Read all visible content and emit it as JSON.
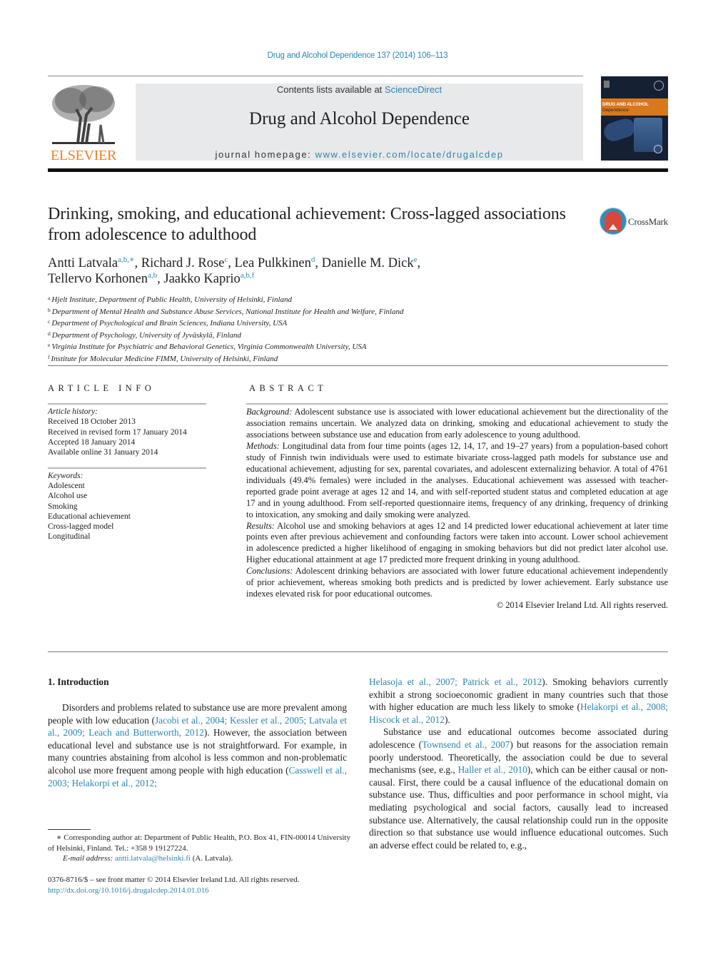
{
  "header": {
    "citation": "Drug and Alcohol Dependence 137 (2014) 106–113",
    "contents_prefix": "Contents lists available at ",
    "contents_link": "ScienceDirect",
    "journal_title": "Drug and Alcohol Dependence",
    "homepage_prefix": "journal homepage: ",
    "homepage_link": "www.elsevier.com/locate/drugalcdep",
    "publisher_logo_text": "ELSEVIER",
    "cover_title": "DRUG AND ALCOHOL",
    "cover_subtitle": "Dependence",
    "colors": {
      "link": "#2a86b0",
      "elsevier_orange": "#f07f2a",
      "cover_orange": "#d7781d"
    }
  },
  "article": {
    "title": "Drinking, smoking, and educational achievement: Cross-lagged associations from adolescence to adulthood",
    "crossmark_label": "CrossMark",
    "authors": [
      {
        "name": "Antti Latvala",
        "sup": "a,b,∗",
        "sep": ", "
      },
      {
        "name": "Richard J. Rose",
        "sup": "c",
        "sep": ", "
      },
      {
        "name": "Lea Pulkkinen",
        "sup": "d",
        "sep": ", "
      },
      {
        "name": "Danielle M. Dick",
        "sup": "e",
        "sep": ","
      },
      {
        "name": "Tellervo Korhonen",
        "sup": "a,b",
        "sep": ", "
      },
      {
        "name": "Jaakko Kaprio",
        "sup": "a,b,f",
        "sep": ""
      }
    ],
    "affiliations": [
      {
        "key": "a",
        "text": "Hjelt Institute, Department of Public Health, University of Helsinki, Finland"
      },
      {
        "key": "b",
        "text": "Department of Mental Health and Substance Abuse Services, National Institute for Health and Welfare, Finland"
      },
      {
        "key": "c",
        "text": "Department of Psychological and Brain Sciences, Indiana University, USA"
      },
      {
        "key": "d",
        "text": "Department of Psychology, University of Jyväskylä, Finland"
      },
      {
        "key": "e",
        "text": "Virginia Institute for Psychiatric and Behavioral Genetics, Virginia Commonwealth University, USA"
      },
      {
        "key": "f",
        "text": "Institute for Molecular Medicine FIMM, University of Helsinki, Finland"
      }
    ]
  },
  "article_info": {
    "heading": "ARTICLE INFO",
    "history_label": "Article history:",
    "history": [
      "Received 18 October 2013",
      "Received in revised form 17 January 2014",
      "Accepted 18 January 2014",
      "Available online 31 January 2014"
    ],
    "keywords_label": "Keywords:",
    "keywords": [
      "Adolescent",
      "Alcohol use",
      "Smoking",
      "Educational achievement",
      "Cross-lagged model",
      "Longitudinal"
    ]
  },
  "abstract": {
    "heading": "ABSTRACT",
    "sections": [
      {
        "label": "Background:",
        "text": " Adolescent substance use is associated with lower educational achievement but the direc­tionality of the association remains uncertain. We analyzed data on drinking, smoking and educational achievement to study the associations between substance use and education from early adolescence to young adulthood."
      },
      {
        "label": "Methods:",
        "text": " Longitudinal data from four time points (ages 12, 14, 17, and 19–27 years) from a population-based cohort study of Finnish twin individuals were used to estimate bivariate cross-lagged path models for substance use and educational achievement, adjusting for sex, parental covariates, and adolescent externalizing behavior. A total of 4761 individuals (49.4% females) were included in the analyses. Edu­cational achievement was assessed with teacher-reported grade point average at ages 12 and 14, and with self-reported student status and completed education at age 17 and in young adulthood. From self-reported questionnaire items, frequency of any drinking, frequency of drinking to intoxication, any smoking and daily smoking were analyzed."
      },
      {
        "label": "Results:",
        "text": " Alcohol use and smoking behaviors at ages 12 and 14 predicted lower educational achievement at later time points even after previous achievement and confounding factors were taken into account. Lower school achievement in adolescence predicted a higher likelihood of engaging in smoking behaviors but did not predict later alcohol use. Higher educational attainment at age 17 predicted more frequent drinking in young adulthood."
      },
      {
        "label": "Conclusions:",
        "text": " Adolescent drinking behaviors are associated with lower future educational achievement independently of prior achievement, whereas smoking both predicts and is predicted by lower achieve­ment. Early substance use indexes elevated risk for poor educational outcomes."
      }
    ],
    "copyright": "© 2014 Elsevier Ireland Ltd. All rights reserved."
  },
  "body": {
    "section_heading": "1.  Introduction",
    "left_para": [
      {
        "t": "Disorders and problems related to substance use are more prevalent among people with low education ("
      },
      {
        "link": "Jacobi et al., 2004; Kessler et al., 2005; Latvala et al., 2009; Leach and Butterworth, 2012"
      },
      {
        "t": "). However, the association between educa­tional level and substance use is not straightforward. For example, in many countries abstaining from alcohol is less common and non-problematic alcohol use more frequent among people with high education ("
      },
      {
        "link": "Casswell et al., 2003; Helakorpi et al., 2012;"
      }
    ],
    "right_para1": [
      {
        "link": "Helasoja et al., 2007; Patrick et al., 2012"
      },
      {
        "t": "). Smoking behaviors cur­rently exhibit a strong socioeconomic gradient in many countries such that those with higher education are much less likely to smoke ("
      },
      {
        "link": "Helakorpi et al., 2008; Hiscock et al., 2012"
      },
      {
        "t": ")."
      }
    ],
    "right_para2": [
      {
        "t": "Substance use and educational outcomes become associated during adolescence ("
      },
      {
        "link": "Townsend et al., 2007"
      },
      {
        "t": ") but reasons for the association remain poorly understood. Theoretically, the associa­tion could be due to several mechanisms (see, e.g., "
      },
      {
        "link": "Haller et al., 2010"
      },
      {
        "t": "), which can be either causal or non-causal. First, there could be a causal influence of the educational domain on substance use. Thus, difficulties and poor performance in school might, via medi­ating psychological and social factors, causally lead to increased substance use. Alternatively, the causal relationship could run in the opposite direction so that substance use would influence edu­cational outcomes. Such an adverse effect could be related to, e.g.,"
      }
    ]
  },
  "footnotes": {
    "corresponding": "∗  Corresponding author at: Department of Public Health, P.O. Box 41, FIN-00014 University of Helsinki, Finland. Tel.: +358 9 19127224.",
    "email_label": "E-mail address:",
    "email": "antti.latvala@helsinki.fi",
    "email_suffix": " (A. Latvala).",
    "issn": "0376-8716/$ – see front matter © 2014 Elsevier Ireland Ltd. All rights reserved.",
    "doi": "http://dx.doi.org/10.1016/j.drugalcdep.2014.01.016"
  }
}
